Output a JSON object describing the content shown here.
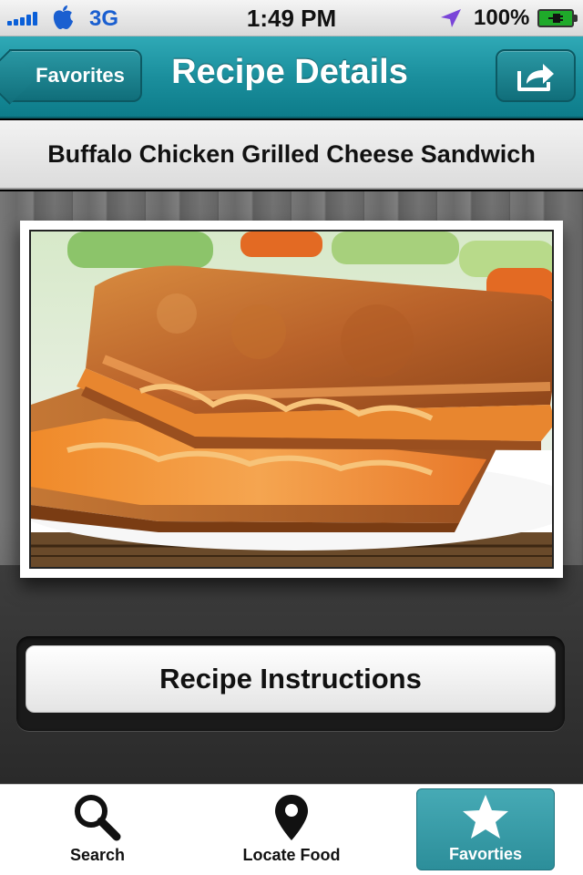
{
  "status_bar": {
    "carrier": "3G",
    "time": "1:49 PM",
    "battery": "100%",
    "signal_bars": 5,
    "icons": [
      "signal-bars-icon",
      "apple-logo-icon",
      "location-arrow-icon",
      "battery-charging-icon"
    ]
  },
  "nav": {
    "back_label": "Favorites",
    "title": "Recipe Details",
    "share_icon": "share-icon"
  },
  "recipe": {
    "title": "Buffalo Chicken Grilled Cheese Sandwich"
  },
  "actions": {
    "instructions_label": "Recipe Instructions"
  },
  "tab_bar": {
    "tabs": [
      {
        "label": "Search",
        "icon": "search-icon",
        "selected": false
      },
      {
        "label": "Locate Food",
        "icon": "map-pin-icon",
        "selected": false
      },
      {
        "label": "Favorties",
        "icon": "star-icon",
        "selected": true
      }
    ]
  },
  "colors": {
    "accent": "#1b8f9d",
    "selected_tab": "#3a9ea9"
  }
}
